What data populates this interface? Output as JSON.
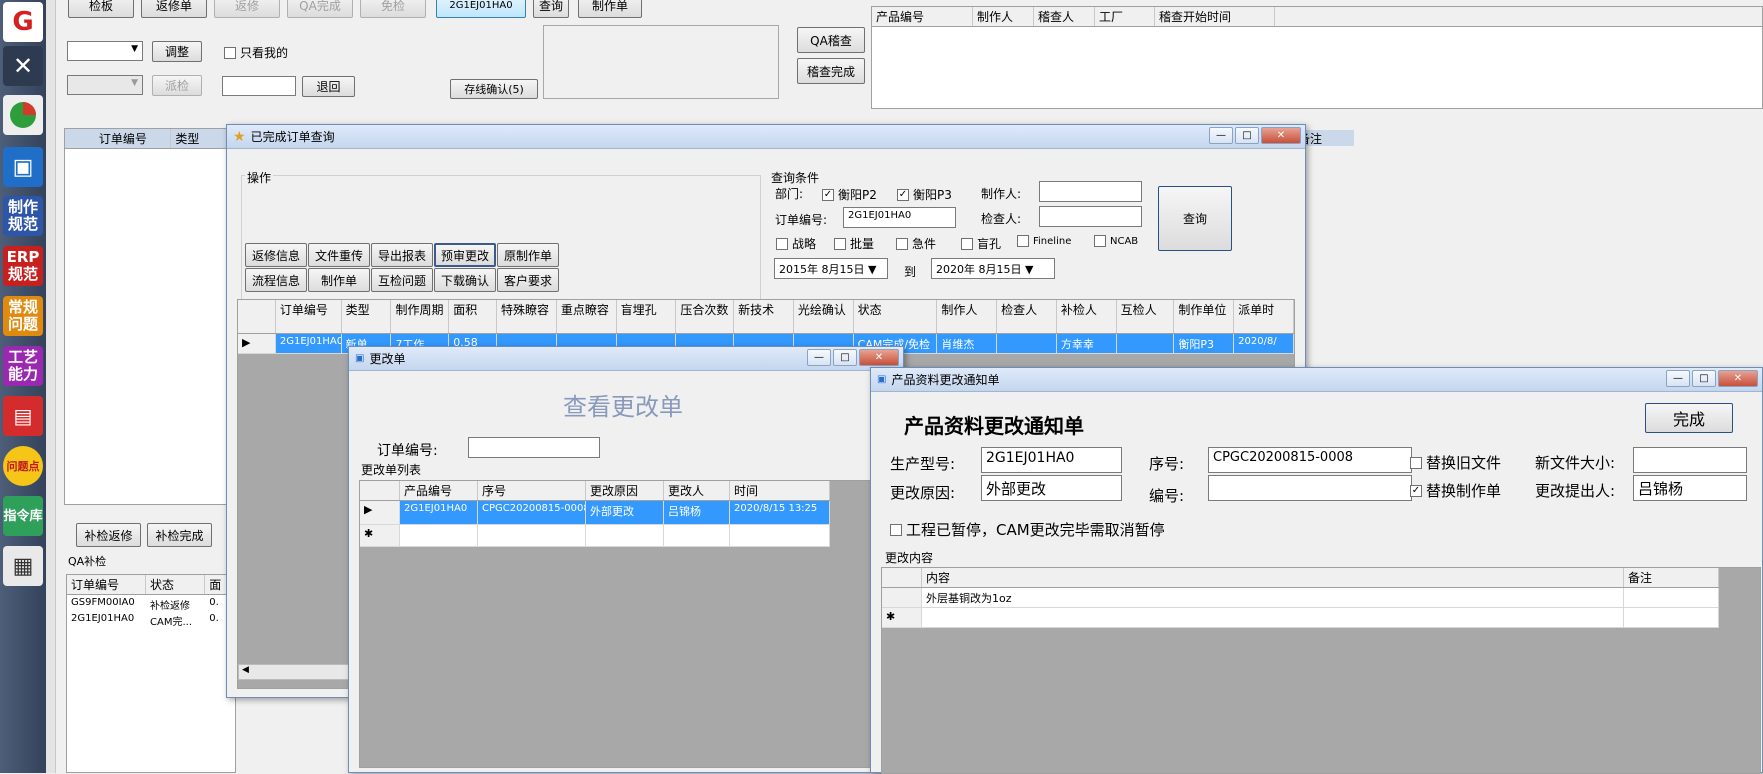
{
  "toolbar": {
    "b1": "检板",
    "b2": "返修单",
    "b3": "返修",
    "b4": "QA完成",
    "b5": "免检",
    "order_display": "2G1EJ01HA0",
    "query": "查询",
    "make_order": "制作单",
    "adjust": "调整",
    "only_mine": "只看我的",
    "dispatch": "派检",
    "withdraw": "退回",
    "online_confirm": "存线确认(5)",
    "qa_audit": "QA稽查",
    "audit_done": "稽查完成"
  },
  "audit_grid": {
    "headers": [
      "产品编号",
      "制作人",
      "稽查人",
      "工厂",
      "稽查开始时间"
    ]
  },
  "main_grid": {
    "headers": [
      "订单编号",
      "类型"
    ],
    "tail_header": "备注"
  },
  "qa_buttons": {
    "b1": "补检返修",
    "b2": "补检完成"
  },
  "qa_supp": {
    "title": "QA补检",
    "headers": [
      "订单编号",
      "状态",
      "面"
    ],
    "rows": [
      [
        "GS9FM00IA0",
        "补检返修",
        "0."
      ],
      [
        "2G1EJ01HA0",
        "CAM完...",
        "0."
      ]
    ]
  },
  "sidebar": {
    "erp": "ERP规范",
    "norm": "制作规范",
    "common": "常规问题",
    "process": "工艺能力",
    "issue": "问题点",
    "guide": "指令库"
  },
  "w_done": {
    "title": "已完成订单查询",
    "ops_label": "操作",
    "ops": [
      "返修信息",
      "文件重传",
      "导出报表",
      "预审更改",
      "原制作单",
      "流程信息",
      "制作单",
      "互检问题",
      "下载确认",
      "客户要求"
    ],
    "cond_label": "查询条件",
    "dept_label": "部门:",
    "dept1": "衡阳P2",
    "dept2": "衡阳P3",
    "maker_label": "制作人:",
    "order_label": "订单编号:",
    "order_value": "2G1EJ01HA0",
    "checker_label": "检查人:",
    "query": "查询",
    "flags": [
      "战略",
      "批量",
      "急件",
      "盲孔",
      "Fineline",
      "NCAB"
    ],
    "date_from": "2015年  8月15日",
    "to": "到",
    "date_to": "2020年  8月15日",
    "headers": [
      "订单编号",
      "类型",
      "制作周期",
      "面积",
      "特殊瞭容",
      "重点瞭容",
      "盲埋孔",
      "压合次数",
      "新技术",
      "光绘确认",
      "状态",
      "制作人",
      "检查人",
      "补检人",
      "互检人",
      "制作单位",
      "派单时"
    ],
    "row": [
      "2G1EJ01HA0",
      "新单",
      "7工作",
      "0.58",
      "",
      "",
      "",
      "",
      "",
      "",
      "CAM完成/免检",
      "肖维杰",
      "",
      "方幸幸",
      "",
      "衡阳P3",
      "2020/8/"
    ]
  },
  "w_change": {
    "title": "更改单",
    "heading": "查看更改单",
    "order_label": "订单编号:",
    "list_label": "更改单列表",
    "headers": [
      "产品编号",
      "序号",
      "更改原因",
      "更改人",
      "时间"
    ],
    "row": [
      "2G1EJ01HA0",
      "CPGC20200815-0008",
      "外部更改",
      "吕锦杨",
      "2020/8/15 13:25"
    ]
  },
  "w_notice": {
    "title": "产品资料更改通知单",
    "heading": "产品资料更改通知单",
    "done": "完成",
    "model_label": "生产型号:",
    "model_value": "2G1EJ01HA0",
    "seq_label": "序号:",
    "seq_value": "CPGC20200815-0008",
    "replace_old": "替换旧文件",
    "new_size_label": "新文件大小:",
    "reason_label": "更改原因:",
    "reason_value": "外部更改",
    "code_label": "编号:",
    "replace_make": "替换制作单",
    "proposer_label": "更改提出人:",
    "proposer_value": "吕锦杨",
    "paused": "工程已暂停，CAM更改完毕需取消暂停",
    "content_label": "更改内容",
    "headers": [
      "内容",
      "备注"
    ],
    "row": [
      "外层基铜改为1oz",
      ""
    ]
  }
}
